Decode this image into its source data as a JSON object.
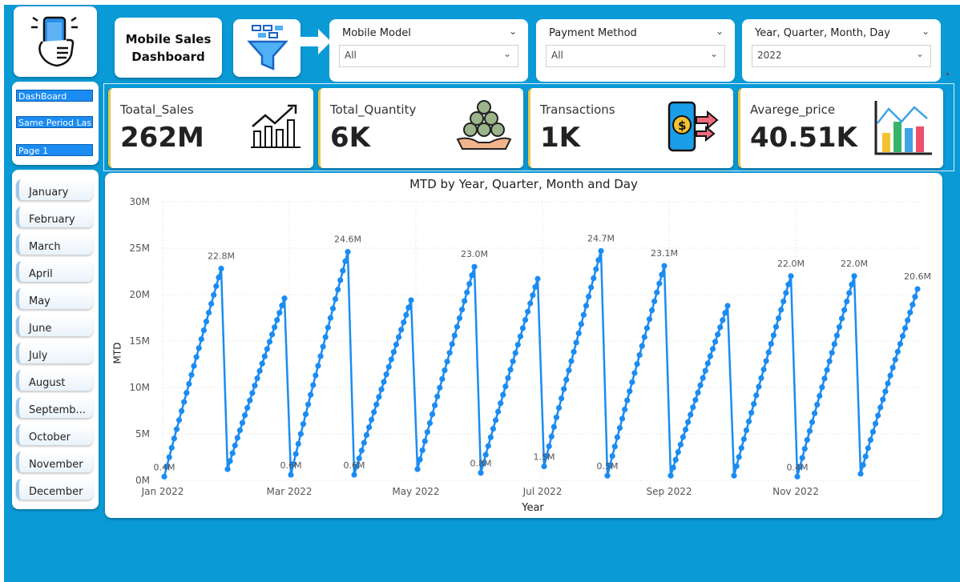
{
  "header": {
    "title": "Mobile Sales Dashboard",
    "title_line1": "Mobile Sales",
    "title_line2": "Dashboard"
  },
  "filters": [
    {
      "label": "Mobile Model",
      "value": "All"
    },
    {
      "label": "Payment Method",
      "value": "All"
    },
    {
      "label": "Year, Quarter, Month, Day",
      "value": "2022"
    }
  ],
  "nav": [
    "DashBoard",
    "Same Period Las...",
    "Page 1"
  ],
  "months": [
    "January",
    "February",
    "March",
    "April",
    "May",
    "June",
    "July",
    "August",
    "Septemb...",
    "October",
    "November",
    "December"
  ],
  "kpis": [
    {
      "label": "Toatal_Sales",
      "value": "262M",
      "icon": "growth-chart-icon"
    },
    {
      "label": "Total_Quantity",
      "value": "6K",
      "icon": "coins-in-hand-icon"
    },
    {
      "label": "Transactions",
      "value": "1K",
      "icon": "mobile-payment-icon"
    },
    {
      "label": "Avarege_price",
      "value": "40.51K",
      "icon": "bar-chart-icon"
    }
  ],
  "colors": {
    "background": "#0a9ad6",
    "accent": "#1b8cf2",
    "kpi_border": "#e7c84a",
    "line": "#1b8cf2"
  },
  "chart_data": {
    "type": "line",
    "title": "MTD by Year, Quarter, Month and Day",
    "xlabel": "Year",
    "ylabel": "MTD",
    "x_ticks": [
      "Jan 2022",
      "Mar 2022",
      "May 2022",
      "Jul 2022",
      "Sep 2022",
      "Nov 2022"
    ],
    "y_ticks": [
      "0M",
      "5M",
      "10M",
      "15M",
      "20M",
      "25M",
      "30M"
    ],
    "ylim": [
      0,
      30
    ],
    "y_unit": "M",
    "grid": true,
    "series": [
      {
        "months": [
          {
            "month": "Jan 2022",
            "start": 0.4,
            "end": 22.8
          },
          {
            "month": "Feb 2022",
            "start": 1.2,
            "end": 19.6
          },
          {
            "month": "Mar 2022",
            "start": 0.6,
            "end": 24.6
          },
          {
            "month": "Apr 2022",
            "start": 0.6,
            "end": 19.4
          },
          {
            "month": "May 2022",
            "start": 1.2,
            "end": 23.0
          },
          {
            "month": "Jun 2022",
            "start": 0.8,
            "end": 21.7
          },
          {
            "month": "Jul 2022",
            "start": 1.5,
            "end": 24.7
          },
          {
            "month": "Aug 2022",
            "start": 0.5,
            "end": 23.1
          },
          {
            "month": "Sep 2022",
            "start": 0.5,
            "end": 18.8
          },
          {
            "month": "Oct 2022",
            "start": 0.5,
            "end": 22.0
          },
          {
            "month": "Nov 2022",
            "start": 0.4,
            "end": 22.0
          },
          {
            "month": "Dec 2022",
            "start": 0.7,
            "end": 20.6
          }
        ]
      }
    ],
    "data_labels": [
      {
        "month": "Jan 2022",
        "position": "start",
        "text": "0.4M"
      },
      {
        "month": "Jan 2022",
        "position": "end",
        "text": "22.8M"
      },
      {
        "month": "Mar 2022",
        "position": "start",
        "text": "0.6M"
      },
      {
        "month": "Mar 2022",
        "position": "end",
        "text": "24.6M"
      },
      {
        "month": "Apr 2022",
        "position": "start",
        "text": "0.6M"
      },
      {
        "month": "May 2022",
        "position": "end",
        "text": "23.0M"
      },
      {
        "month": "Jun 2022",
        "position": "start",
        "text": "0.8M"
      },
      {
        "month": "Jul 2022",
        "position": "start",
        "text": "1.5M"
      },
      {
        "month": "Jul 2022",
        "position": "end",
        "text": "24.7M"
      },
      {
        "month": "Aug 2022",
        "position": "start",
        "text": "0.5M"
      },
      {
        "month": "Aug 2022",
        "position": "end",
        "text": "23.1M"
      },
      {
        "month": "Oct 2022",
        "position": "end",
        "text": "22.0M"
      },
      {
        "month": "Nov 2022",
        "position": "start",
        "text": "0.4M"
      },
      {
        "month": "Nov 2022",
        "position": "end",
        "text": "22.0M"
      },
      {
        "month": "Dec 2022",
        "position": "end",
        "text": "20.6M"
      }
    ]
  }
}
